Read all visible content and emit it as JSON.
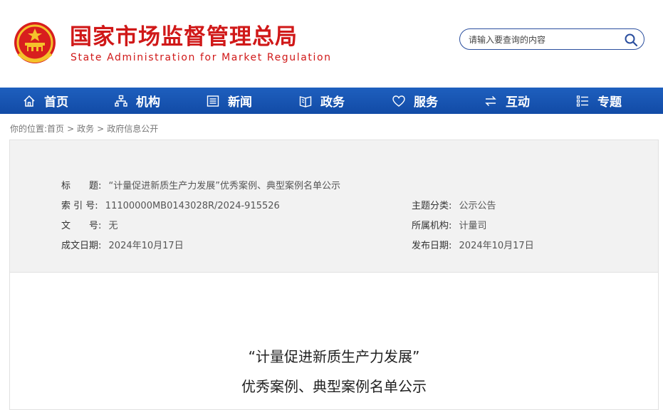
{
  "header": {
    "site_title": "国家市场监督管理总局",
    "site_subtitle": "State Administration for Market Regulation",
    "search_placeholder": "请输入要查询的内容"
  },
  "colors": {
    "brand_red": "#d01818",
    "nav_blue": "#1a57b4",
    "meta_bg": "#f2f2f2"
  },
  "nav": {
    "items": [
      {
        "label": "首页",
        "icon": "home-icon"
      },
      {
        "label": "机构",
        "icon": "org-chart-icon"
      },
      {
        "label": "新闻",
        "icon": "news-icon"
      },
      {
        "label": "政务",
        "icon": "book-icon"
      },
      {
        "label": "服务",
        "icon": "heart-icon"
      },
      {
        "label": "互动",
        "icon": "exchange-icon"
      },
      {
        "label": "专题",
        "icon": "list-icon"
      }
    ]
  },
  "breadcrumb": {
    "prefix": "你的位置:",
    "items": [
      "首页",
      "政务",
      "政府信息公开"
    ],
    "separator": ">"
  },
  "meta": {
    "title_label": "标　　题:",
    "title_value": "“计量促进新质生产力发展”优秀案例、典型案例名单公示",
    "index_label": "索 引 号:",
    "index_value": "11100000MB0143028R/2024-915526",
    "topic_label": "主题分类:",
    "topic_value": "公示公告",
    "docno_label": "文　　号:",
    "docno_value": "无",
    "org_label": "所属机构:",
    "org_value": "计量司",
    "created_label": "成文日期:",
    "created_value": "2024年10月17日",
    "published_label": "发布日期:",
    "published_value": "2024年10月17日"
  },
  "article": {
    "title_line1": "“计量促进新质生产力发展”",
    "title_line2": "优秀案例、典型案例名单公示"
  }
}
